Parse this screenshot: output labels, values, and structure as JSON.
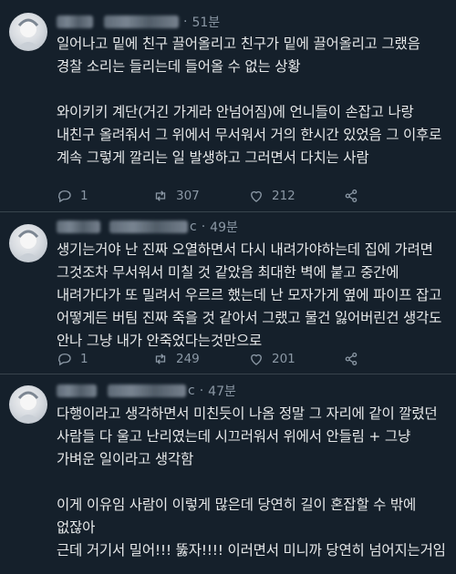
{
  "tweets": [
    {
      "handle_tail": "",
      "time": "51분",
      "text": "일어나고 밑에 친구 끌어올리고 친구가 밑에 끌어올리고 그랬음 경찰 소리는 들리는데 들어올 수 없는 상황\n\n와이키키 계단(거긴 가게라 안넘어짐)에 언니들이 손잡고 나랑 내친구 올려줘서 그 위에서 무서워서 거의 한시간 있었음 그 이후로 계속 그렇게 깔리는 일 발생하고 그러면서 다치는 사람",
      "replies": "1",
      "retweets": "307",
      "likes": "212"
    },
    {
      "handle_tail": "c",
      "time": "49분",
      "text": "생기는거야 난 진짜 오열하면서 다시 내려가야하는데 집에 가려면 그것조차 무서워서 미칠 것 같았음 최대한 벽에 붙고 중간에 내려가다가 또 밀려서 우르르 했는데 난 모자가게 옆에 파이프 잡고 어떻게든 버팀 진짜 죽을 것 같아서 그랬고 물건 잃어버린건 생각도 안나 그냥 내가 안죽었다는것만으로",
      "replies": "1",
      "retweets": "249",
      "likes": "201"
    },
    {
      "handle_tail": "c",
      "time": "47분",
      "text": "다행이라고 생각하면서 미친듯이 나옴 정말 그 자리에 같이 깔렸던 사람들 다 울고 난리였는데 시끄러워서 위에서 안들림 + 그냥 가벼운 일이라고 생각함\n\n이게 이유임 사람이 이렇게 많은데 당연히 길이 혼잡할 수 밖에 없잖아\n근데 거기서 밀어!!! 뚫자!!!! 이러면서 미니까 당연히 넘어지는거임"
    }
  ],
  "separator": "·",
  "icons": [
    "reply-icon",
    "retweet-icon",
    "like-icon",
    "share-icon"
  ],
  "colors": {
    "background": "#15202b",
    "text": "#e7e9ea",
    "muted": "#8b98a5",
    "divider": "#38444d"
  }
}
